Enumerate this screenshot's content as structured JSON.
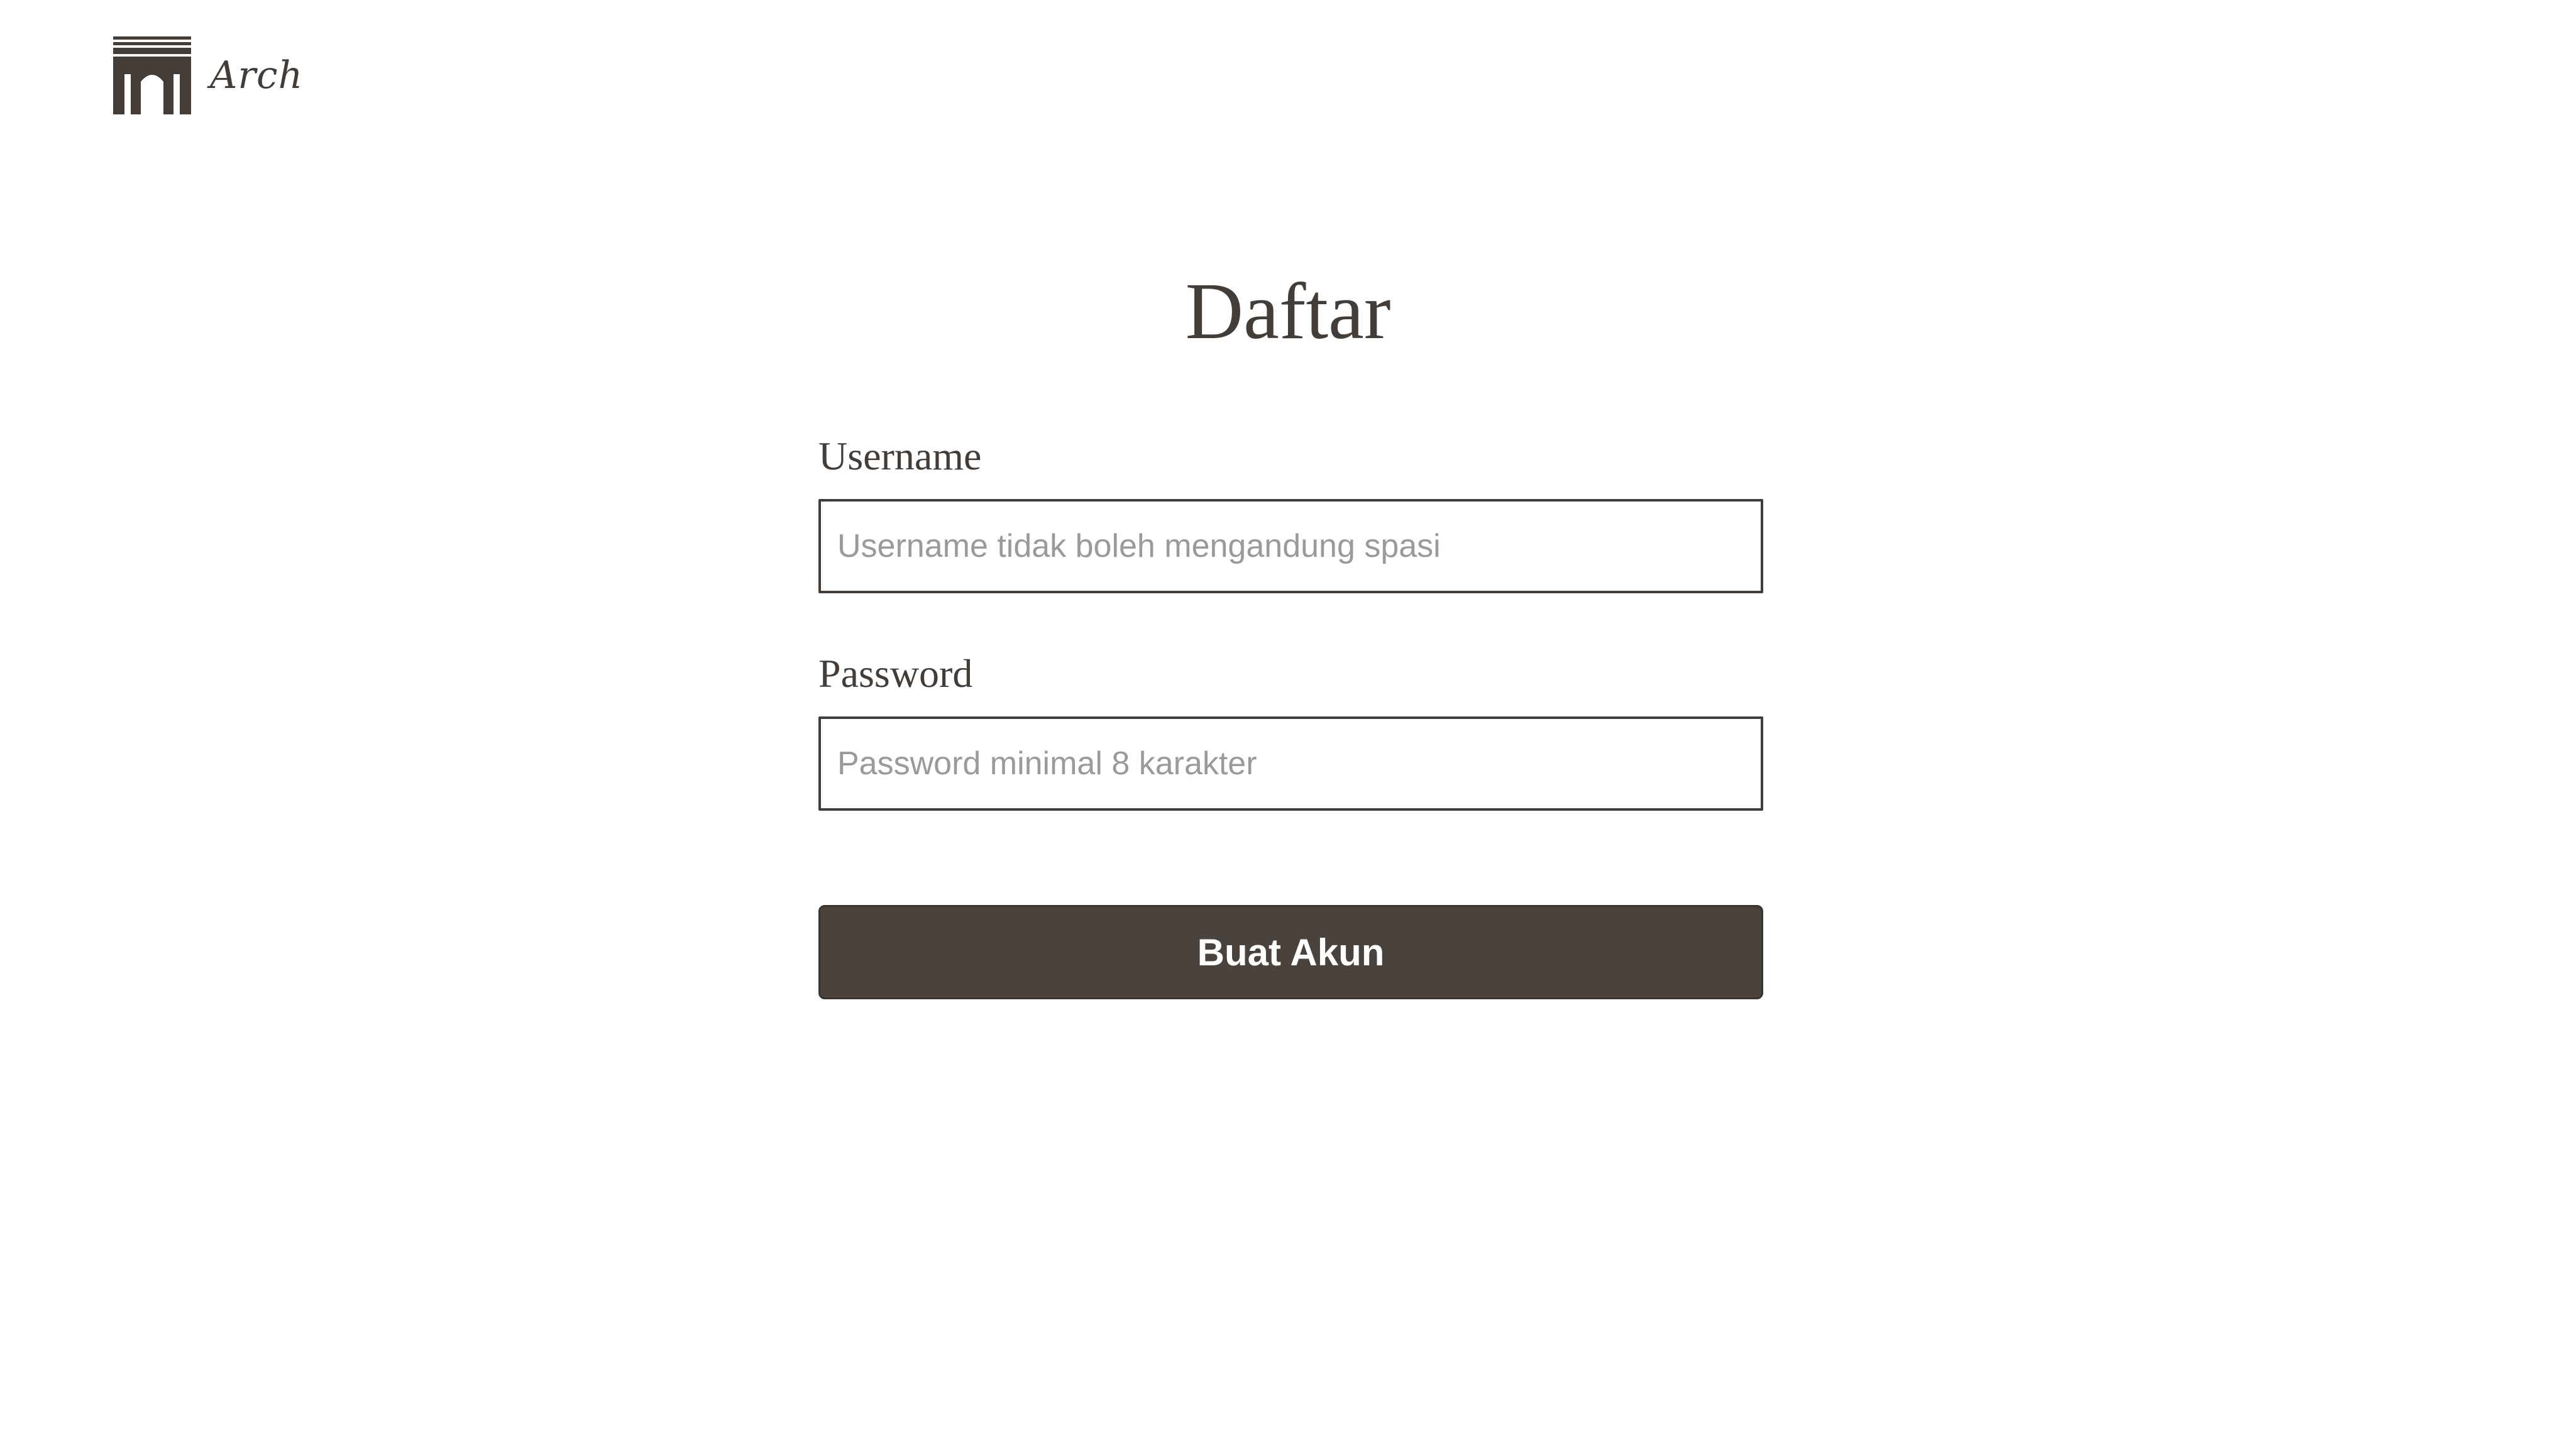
{
  "brand": {
    "name": "Arch",
    "icon": "arch-building-icon"
  },
  "page": {
    "title": "Daftar"
  },
  "form": {
    "username": {
      "label": "Username",
      "value": "",
      "placeholder": "Username tidak boleh mengandung spasi"
    },
    "password": {
      "label": "Password",
      "value": "",
      "placeholder": "Password minimal 8 karakter"
    },
    "submit_label": "Buat Akun"
  },
  "colors": {
    "primary": "#433c37",
    "button_bg": "#4a423d",
    "button_text": "#ffffff",
    "placeholder": "#9a9a9a",
    "background": "#ffffff"
  }
}
